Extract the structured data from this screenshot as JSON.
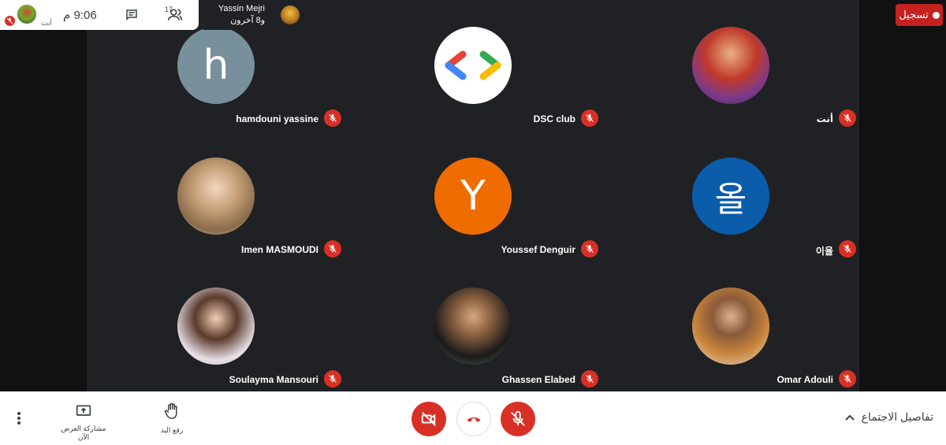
{
  "info_card": {
    "self_label": "أنت",
    "clock": "9:06 م",
    "participant_count": "17"
  },
  "presenter": {
    "name": "Yassin Mejri",
    "others": "و8 آخرون"
  },
  "record": {
    "label": "تسجيل"
  },
  "tiles": [
    {
      "name": "hamdouni yassine",
      "letter": "h",
      "color": "#78909c"
    },
    {
      "name": "DSC club",
      "letter": "",
      "color": "#ffffff"
    },
    {
      "name": "أنت",
      "letter": "",
      "color": "#7b3a8c"
    },
    {
      "name": "Imen MASMOUDI",
      "letter": "",
      "color": "#c8a27a"
    },
    {
      "name": "Youssef Denguir",
      "letter": "Y",
      "color": "#ef6c00"
    },
    {
      "name": "이율",
      "letter": "올",
      "color": "#0b5cab"
    },
    {
      "name": "Soulayma Mansouri",
      "letter": "",
      "color": "#d9cdbf"
    },
    {
      "name": "Ghassen Elabed",
      "letter": "",
      "color": "#5a6b5c"
    },
    {
      "name": "Omar Adouli",
      "letter": "",
      "color": "#e8e0d5"
    }
  ],
  "bottom": {
    "present_label": "مشاركة العرض الآن",
    "hand_label": "رفع اليد",
    "details_label": "تفاصيل الاجتماع"
  },
  "colors": {
    "stage_bg": "#202124",
    "muted_red": "#d93025",
    "record_red": "#c5221f"
  }
}
